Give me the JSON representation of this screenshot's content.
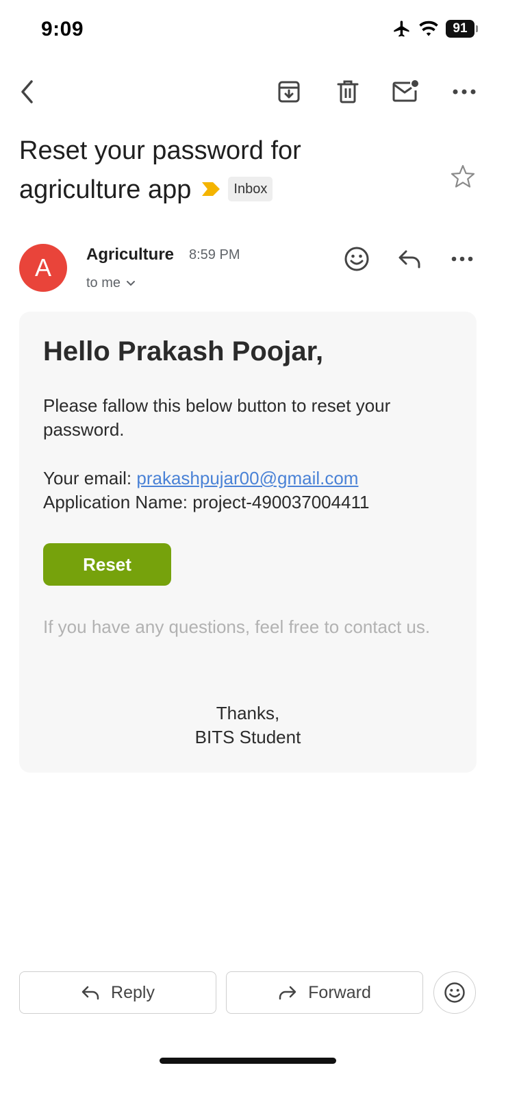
{
  "status_bar": {
    "time": "9:09",
    "battery": "91"
  },
  "toolbar": {
    "back_icon": "chevron-left-icon",
    "archive_icon": "archive-icon",
    "delete_icon": "trash-icon",
    "unread_icon": "mark-unread-icon",
    "more_icon": "more-horizontal-icon"
  },
  "subject": {
    "line1": "Reset your password for",
    "line2": "agriculture app",
    "label": "Inbox",
    "important_color": "#f4b400"
  },
  "sender": {
    "initial": "A",
    "name": "Agriculture",
    "time": "8:59 PM",
    "recipient": "to me",
    "avatar_color": "#e9443a"
  },
  "email": {
    "greeting": "Hello Prakash Poojar,",
    "body": "Please fallow this below button to reset your password.",
    "email_label": "Your email:",
    "email_value": "prakashpujar00@gmail.com",
    "app_label": "Application Name:",
    "app_value": "project-490037004411",
    "button_label": "Reset",
    "button_color": "#76a20c",
    "questions": "If you have any questions, feel free to contact us.",
    "thanks": "Thanks,",
    "signature": "BITS Student"
  },
  "actions": {
    "reply_label": "Reply",
    "forward_label": "Forward"
  }
}
